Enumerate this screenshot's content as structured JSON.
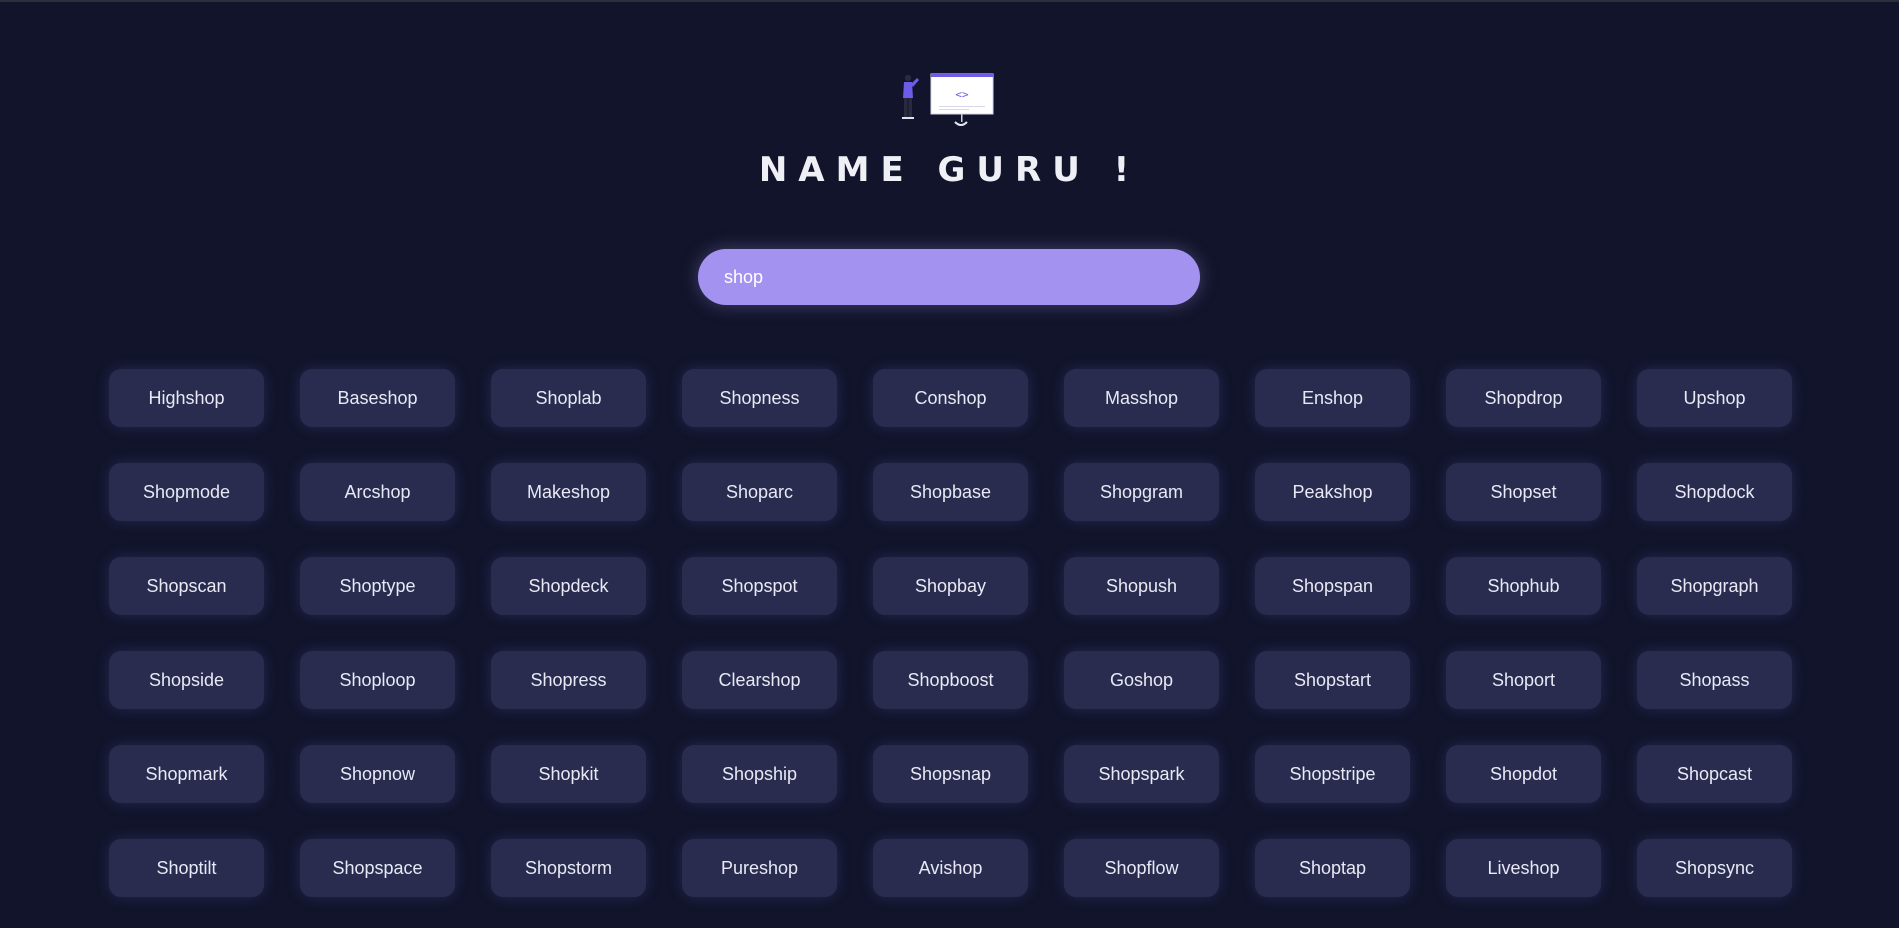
{
  "header": {
    "title": "NAME GURU !",
    "illustration_icon": "developer-at-screen-illustration"
  },
  "search": {
    "value": "shop"
  },
  "colors": {
    "background": "#11142a",
    "accent": "#a492f0",
    "card": "#292c4f",
    "text": "#e8e9f4"
  },
  "results": [
    "Highshop",
    "Baseshop",
    "Shoplab",
    "Shopness",
    "Conshop",
    "Masshop",
    "Enshop",
    "Shopdrop",
    "Upshop",
    "Shopmode",
    "Arcshop",
    "Makeshop",
    "Shoparc",
    "Shopbase",
    "Shopgram",
    "Peakshop",
    "Shopset",
    "Shopdock",
    "Shopscan",
    "Shoptype",
    "Shopdeck",
    "Shopspot",
    "Shopbay",
    "Shopush",
    "Shopspan",
    "Shophub",
    "Shopgraph",
    "Shopside",
    "Shoploop",
    "Shopress",
    "Clearshop",
    "Shopboost",
    "Goshop",
    "Shopstart",
    "Shoport",
    "Shopass",
    "Shopmark",
    "Shopnow",
    "Shopkit",
    "Shopship",
    "Shopsnap",
    "Shopspark",
    "Shopstripe",
    "Shopdot",
    "Shopcast",
    "Shoptilt",
    "Shopspace",
    "Shopstorm",
    "Pureshop",
    "Avishop",
    "Shopflow",
    "Shoptap",
    "Liveshop",
    "Shopsync"
  ]
}
